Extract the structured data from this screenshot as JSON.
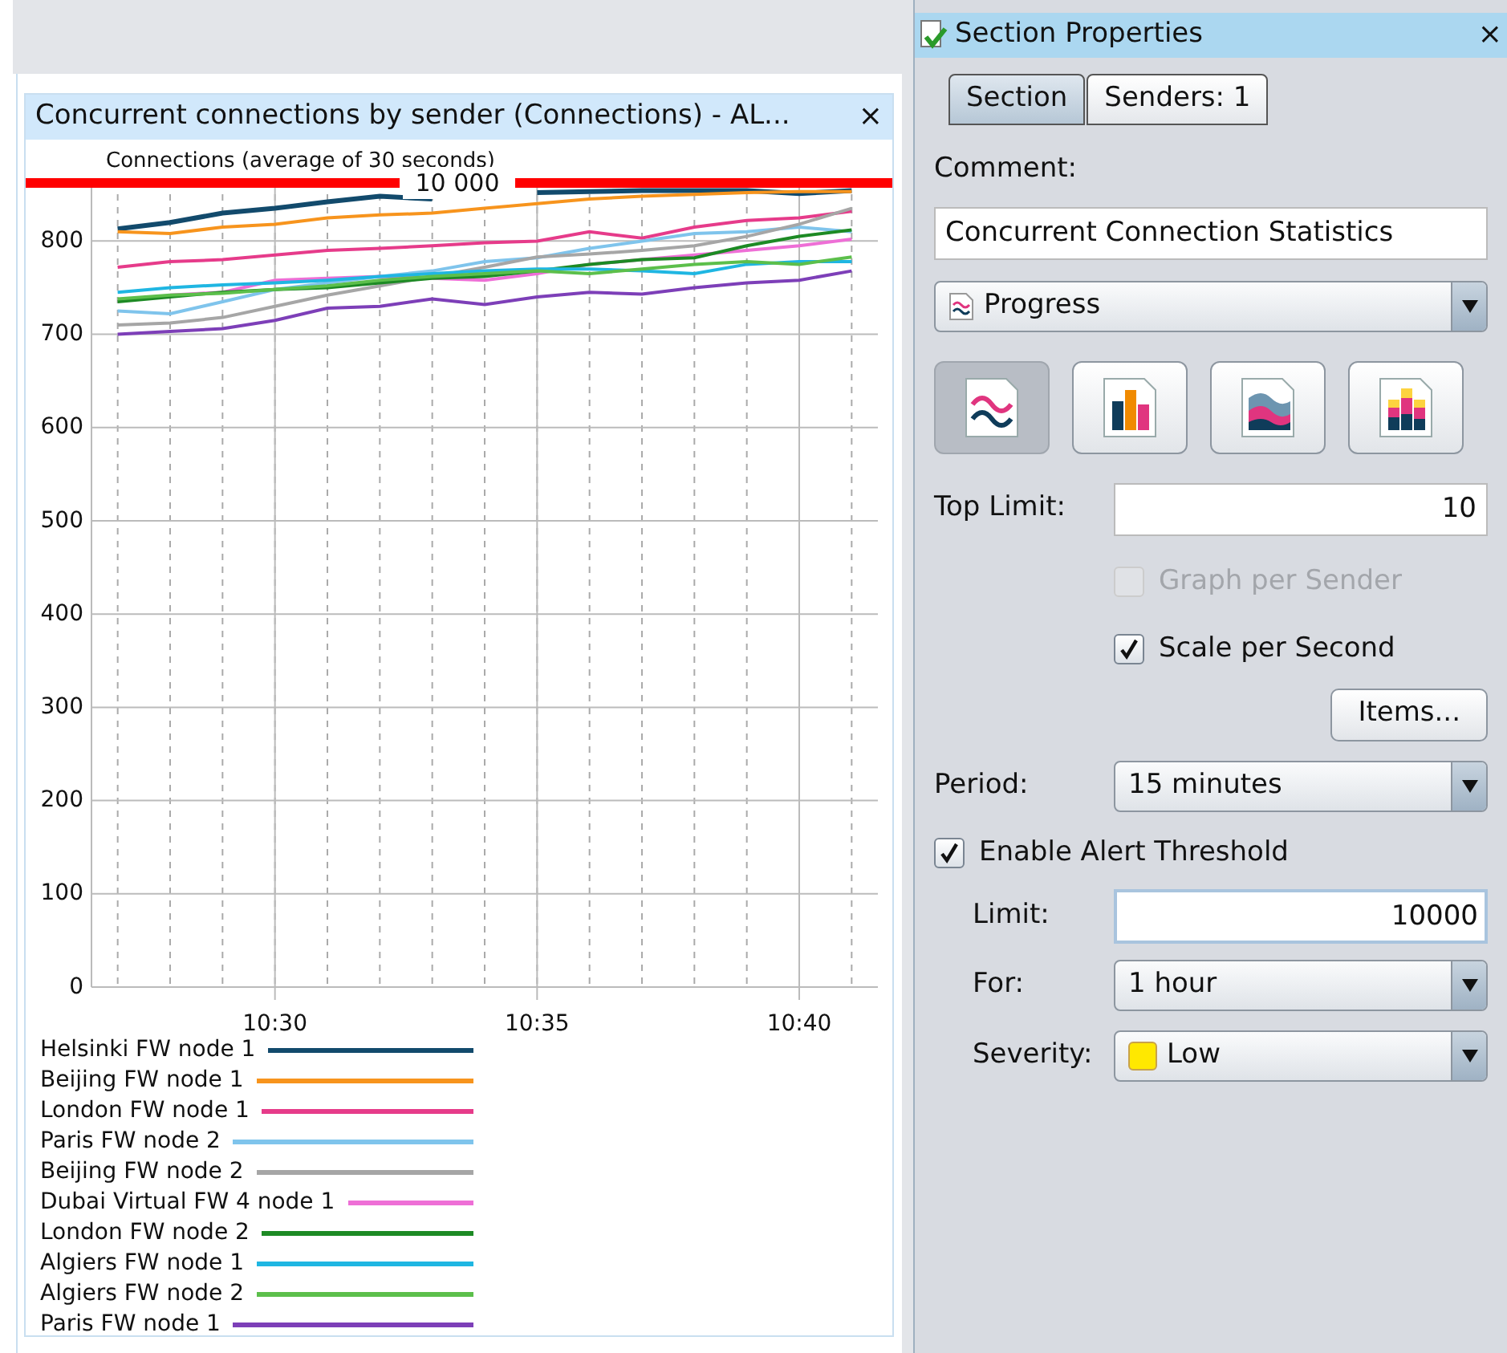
{
  "chart_panel": {
    "title": "Concurrent connections by sender (Connections) - AL...",
    "close": "×",
    "threshold": {
      "label": "10 000",
      "color": "#ff0000"
    },
    "chart_data": {
      "type": "line",
      "title": "Connections (average of 30 seconds)",
      "grid": true,
      "categories": [
        null,
        null,
        null,
        "10:30",
        null,
        null,
        null,
        null,
        "10:35",
        null,
        null,
        null,
        null,
        "10:40",
        null
      ],
      "ylim": [
        0,
        864
      ],
      "yticks": [
        0,
        100,
        200,
        300,
        400,
        500,
        600,
        700,
        800
      ],
      "series": [
        {
          "name": "Helsinki FW node 1",
          "color": "#124a6c",
          "values": [
            813,
            820,
            830,
            835,
            842,
            848,
            845,
            null,
            852,
            853,
            854,
            854,
            854,
            851,
            854
          ]
        },
        {
          "name": "Beijing FW node 1",
          "color": "#f7941d",
          "values": [
            810,
            808,
            815,
            818,
            825,
            828,
            830,
            835,
            840,
            845,
            848,
            850,
            852,
            853,
            853
          ]
        },
        {
          "name": "London FW node 1",
          "color": "#e63b8a",
          "values": [
            772,
            778,
            780,
            785,
            790,
            792,
            795,
            798,
            800,
            810,
            803,
            815,
            822,
            825,
            832
          ]
        },
        {
          "name": "Paris FW node 2",
          "color": "#7fc4ec",
          "values": [
            725,
            722,
            735,
            748,
            755,
            762,
            768,
            778,
            782,
            792,
            800,
            808,
            810,
            815,
            810
          ]
        },
        {
          "name": "Beijing FW node 2",
          "color": "#a6a6a6",
          "values": [
            710,
            712,
            718,
            730,
            742,
            752,
            762,
            772,
            783,
            786,
            790,
            795,
            805,
            818,
            835
          ]
        },
        {
          "name": "Dubai Virtual FW 4 node 1",
          "color": "#ee6fd6",
          "values": [
            null,
            742,
            745,
            758,
            760,
            762,
            760,
            758,
            765,
            775,
            780,
            785,
            790,
            795,
            802
          ]
        },
        {
          "name": "London FW node 2",
          "color": "#1d8a24",
          "values": [
            735,
            740,
            745,
            748,
            750,
            755,
            760,
            762,
            768,
            775,
            780,
            782,
            795,
            805,
            812
          ]
        },
        {
          "name": "Algiers FW node 1",
          "color": "#1fb6e2",
          "values": [
            745,
            750,
            753,
            755,
            758,
            762,
            765,
            768,
            770,
            770,
            768,
            765,
            775,
            778,
            778
          ]
        },
        {
          "name": "Algiers FW node 2",
          "color": "#5cbf4b",
          "values": [
            738,
            742,
            744,
            748,
            752,
            758,
            762,
            765,
            768,
            765,
            770,
            775,
            778,
            775,
            783
          ]
        },
        {
          "name": "Paris FW node 1",
          "color": "#7d3fb8",
          "values": [
            700,
            703,
            706,
            715,
            728,
            730,
            738,
            732,
            740,
            745,
            743,
            750,
            755,
            758,
            768
          ]
        }
      ]
    }
  },
  "properties": {
    "title": "Section Properties",
    "close": "×",
    "tabs": [
      {
        "label": "Section",
        "selected": true
      },
      {
        "label": "Senders: 1",
        "selected": false
      }
    ],
    "comment_label": "Comment:",
    "comment": "Concurrent Connection Statistics",
    "style": {
      "value": "Progress"
    },
    "chart_types": [
      {
        "kind": "line",
        "selected": true
      },
      {
        "kind": "bar",
        "selected": false
      },
      {
        "kind": "area",
        "selected": false
      },
      {
        "kind": "stacked",
        "selected": false
      }
    ],
    "top_limit": {
      "label": "Top Limit:",
      "value": "10"
    },
    "checks": [
      {
        "label": "Graph per Sender",
        "checked": false,
        "disabled": true
      },
      {
        "label": "Scale per Second",
        "checked": true,
        "disabled": false
      }
    ],
    "items_button": "Items...",
    "period": {
      "label": "Period:",
      "value": "15 minutes"
    },
    "alert": {
      "label": "Enable Alert Threshold",
      "checked": true
    },
    "limit": {
      "label": "Limit:",
      "value": "10000"
    },
    "for": {
      "label": "For:",
      "value": "1 hour"
    },
    "severity": {
      "label": "Severity:",
      "value": "Low",
      "color": "#ffe800"
    }
  }
}
